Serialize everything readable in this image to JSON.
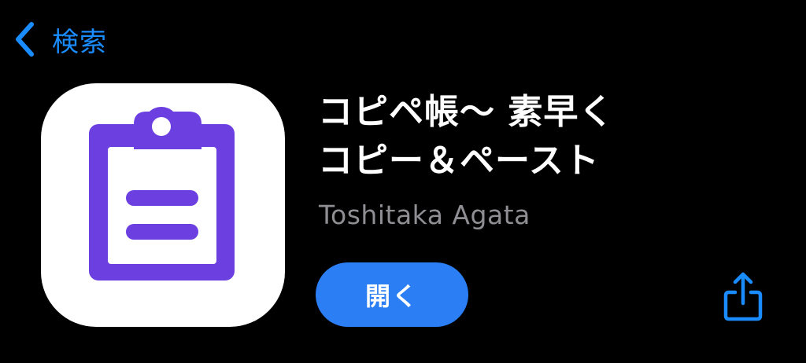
{
  "nav": {
    "back_label": "検索",
    "back_icon": "chevron-left-icon"
  },
  "app": {
    "icon": "clipboard-icon",
    "title_line1": "コピペ帳〜 素早く",
    "title_line2": "コピー＆ペースト",
    "developer": "Toshitaka Agata",
    "open_label": "開く",
    "share_icon": "share-icon"
  },
  "colors": {
    "background": "#000000",
    "accent": "#1a8cff",
    "button": "#2b7ef3",
    "icon_purple": "#6b3fe0",
    "icon_background": "#ffffff",
    "developer_text": "#8e8e93"
  }
}
